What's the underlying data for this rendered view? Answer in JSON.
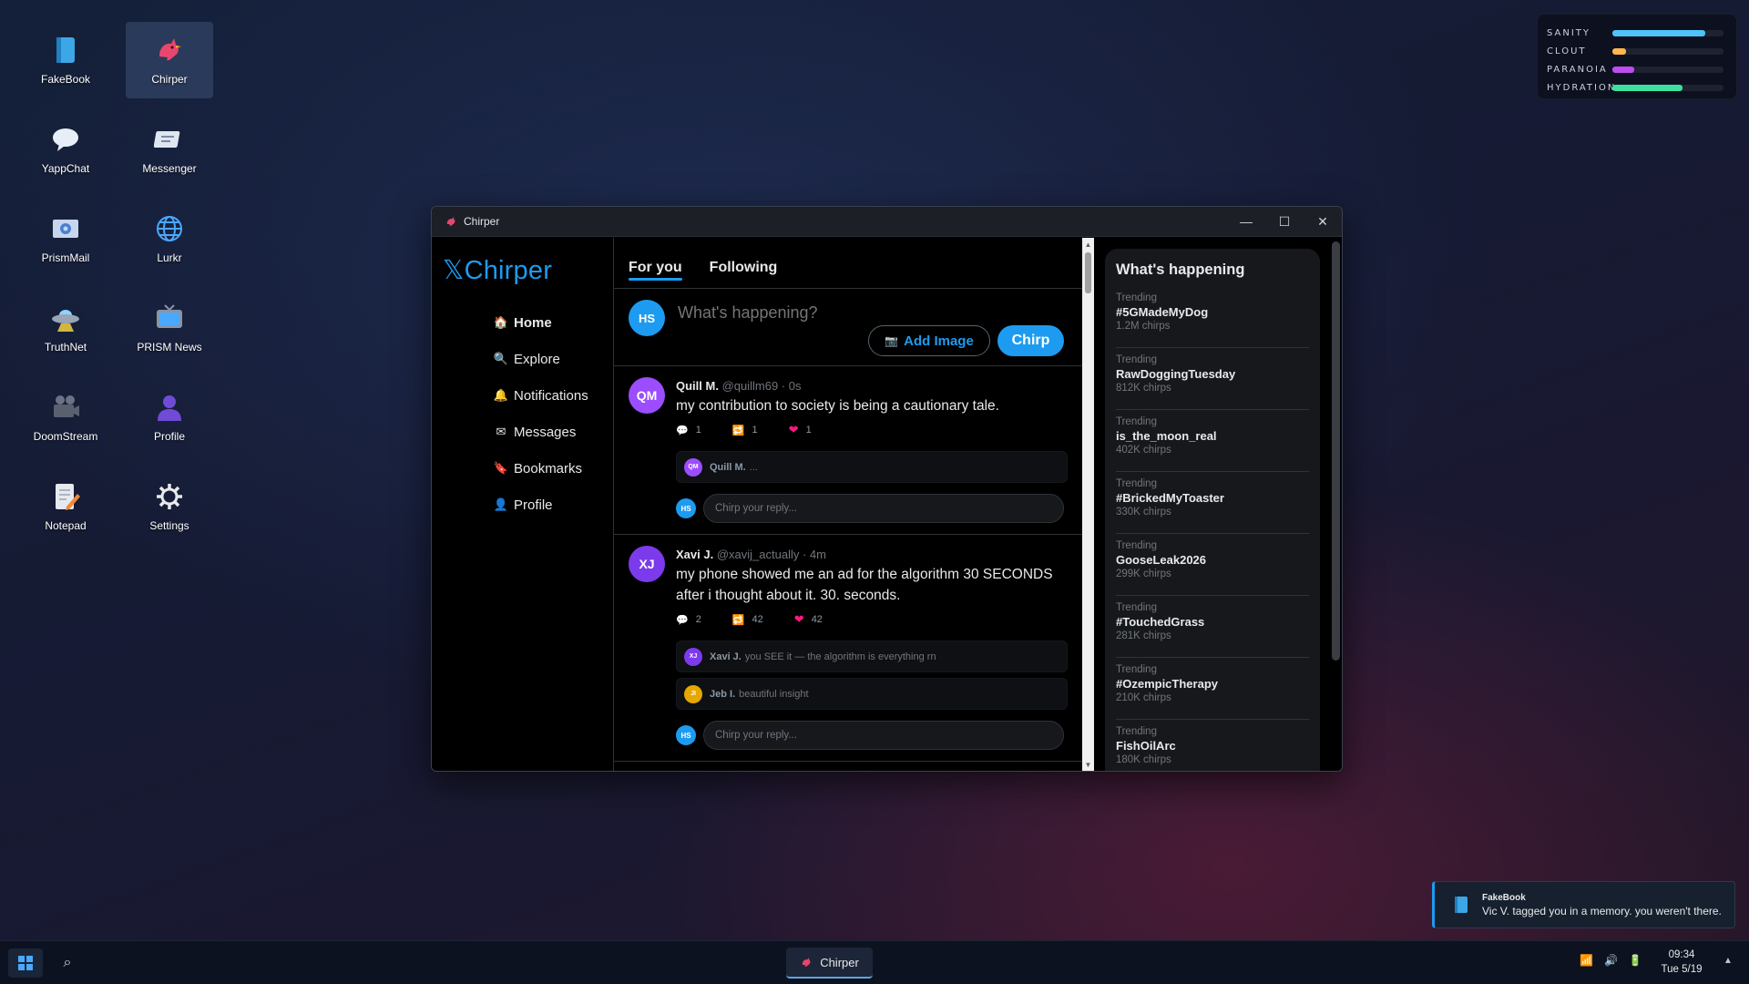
{
  "desktop": {
    "icons": [
      {
        "label": "FakeBook",
        "icon": "book-icon"
      },
      {
        "label": "Chirper",
        "icon": "bird-icon"
      },
      {
        "label": "YappChat",
        "icon": "chat-bubble-icon"
      },
      {
        "label": "Messenger",
        "icon": "message-card-icon"
      },
      {
        "label": "PrismMail",
        "icon": "mail-icon"
      },
      {
        "label": "Lurkr",
        "icon": "globe-icon"
      },
      {
        "label": "TruthNet",
        "icon": "ufo-icon"
      },
      {
        "label": "PRISM News",
        "icon": "tv-icon"
      },
      {
        "label": "DoomStream",
        "icon": "camera-icon"
      },
      {
        "label": "Profile",
        "icon": "person-icon"
      },
      {
        "label": "Notepad",
        "icon": "notepad-icon"
      },
      {
        "label": "Settings",
        "icon": "gear-icon"
      }
    ]
  },
  "hud": {
    "stats": [
      {
        "label": "SANITY",
        "value": 0.84,
        "color": "#4fc3f7"
      },
      {
        "label": "CLOUT",
        "value": 0.12,
        "color": "#ffb74d"
      },
      {
        "label": "PARANOIA",
        "value": 0.2,
        "color": "#c04cf0"
      },
      {
        "label": "HYDRATION",
        "value": 0.63,
        "color": "#3ee0a0"
      }
    ]
  },
  "window": {
    "title": "Chirper",
    "minimize": "—",
    "maximize": "☐",
    "close": "✕"
  },
  "app": {
    "logo": "𝕏Chirper",
    "nav": [
      {
        "label": "Home",
        "icon": "🏠",
        "icon_name": "home-icon",
        "active": true
      },
      {
        "label": "Explore",
        "icon": "🔍",
        "icon_name": "search-icon",
        "active": false
      },
      {
        "label": "Notifications",
        "icon": "🔔",
        "icon_name": "bell-icon",
        "active": false
      },
      {
        "label": "Messages",
        "icon": "✉",
        "icon_name": "envelope-icon",
        "active": false
      },
      {
        "label": "Bookmarks",
        "icon": "🔖",
        "icon_name": "bookmark-icon",
        "active": false
      },
      {
        "label": "Profile",
        "icon": "👤",
        "icon_name": "person-icon",
        "active": false
      }
    ],
    "tabs": [
      {
        "label": "For you",
        "active": true
      },
      {
        "label": "Following",
        "active": false
      }
    ],
    "compose": {
      "avatar": "HS",
      "placeholder": "What's happening?",
      "add_image": "Add Image",
      "chirp": "Chirp"
    },
    "posts": [
      {
        "avatar": "QM",
        "avatar_color": "#9b4dff",
        "name": "Quill M.",
        "meta": "@quillm69 · 0s",
        "text": "my contribution to society is being a cautionary tale.",
        "replies_count": "1",
        "rechirps": "1",
        "likes": "1",
        "replies": [
          {
            "avatar": "QM",
            "color": "#9b4dff",
            "name": "Quill M.",
            "text": "..."
          }
        ],
        "reply_placeholder": "Chirp your reply..."
      },
      {
        "avatar": "XJ",
        "avatar_color": "#7c3aed",
        "name": "Xavi J.",
        "meta": "@xavij_actually · 4m",
        "text": "my phone showed me an ad for the algorithm 30 SECONDS after i thought about it. 30. seconds.",
        "replies_count": "2",
        "rechirps": "42",
        "likes": "42",
        "replies": [
          {
            "avatar": "XJ",
            "color": "#7c3aed",
            "name": "Xavi J.",
            "text": "you SEE it — the algorithm is everything rn"
          },
          {
            "avatar": "JI",
            "color": "#e6a700",
            "name": "Jeb I.",
            "text": "beautiful insight"
          }
        ],
        "reply_placeholder": "Chirp your reply..."
      }
    ],
    "trending": {
      "title": "What's happening",
      "items": [
        {
          "label": "Trending",
          "name": "#5GMadeMyDog",
          "count": "1.2M chirps"
        },
        {
          "label": "Trending",
          "name": "RawDoggingTuesday",
          "count": "812K chirps"
        },
        {
          "label": "Trending",
          "name": "is_the_moon_real",
          "count": "402K chirps"
        },
        {
          "label": "Trending",
          "name": "#BrickedMyToaster",
          "count": "330K chirps"
        },
        {
          "label": "Trending",
          "name": "GooseLeak2026",
          "count": "299K chirps"
        },
        {
          "label": "Trending",
          "name": "#TouchedGrass",
          "count": "281K chirps"
        },
        {
          "label": "Trending",
          "name": "#OzempicTherapy",
          "count": "210K chirps"
        },
        {
          "label": "Trending",
          "name": "FishOilArc",
          "count": "180K chirps"
        }
      ]
    }
  },
  "toast": {
    "app": "FakeBook",
    "message": "Vic V. tagged you in a memory. you weren't there."
  },
  "taskbar": {
    "search_glyph": "⌕",
    "active_app": "Chirper",
    "time": "09:34",
    "date": "Tue 5/19"
  }
}
